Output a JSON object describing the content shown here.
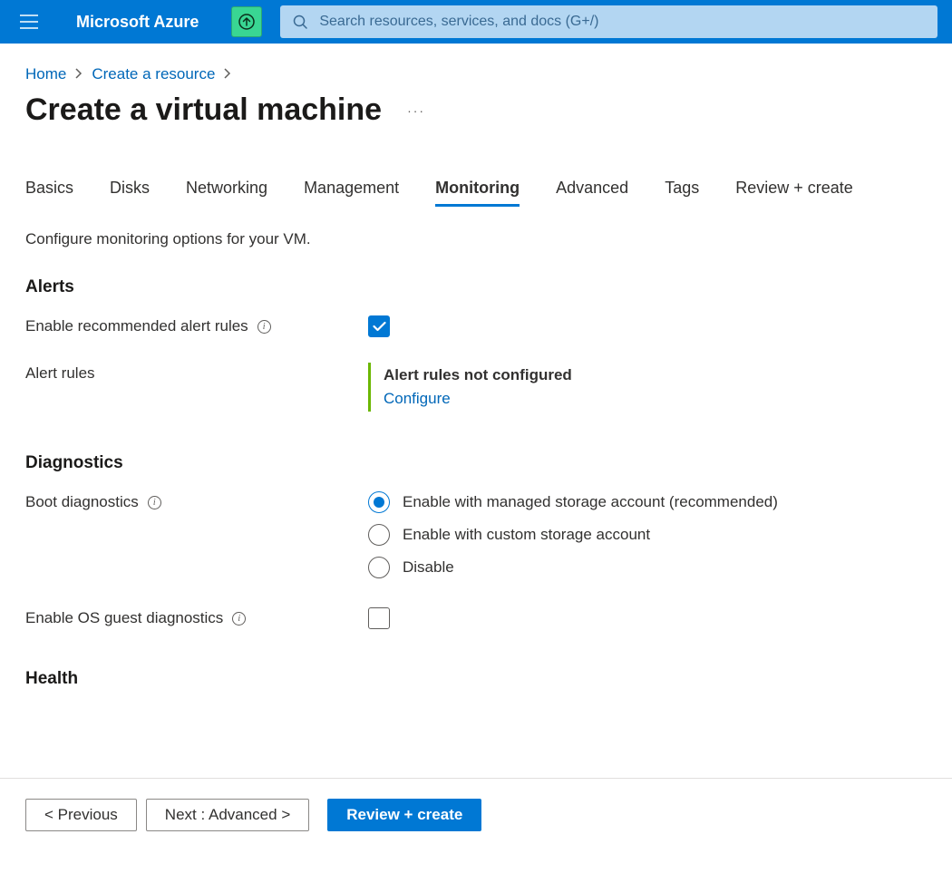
{
  "header": {
    "brand": "Microsoft Azure",
    "search_placeholder": "Search resources, services, and docs (G+/)"
  },
  "breadcrumb": {
    "items": [
      "Home",
      "Create a resource"
    ]
  },
  "page": {
    "title": "Create a virtual machine"
  },
  "tabs": {
    "items": [
      "Basics",
      "Disks",
      "Networking",
      "Management",
      "Monitoring",
      "Advanced",
      "Tags",
      "Review + create"
    ],
    "active_index": 4
  },
  "description": "Configure monitoring options for your VM.",
  "sections": {
    "alerts": {
      "title": "Alerts",
      "enable_recommended_label": "Enable recommended alert rules",
      "enable_recommended_checked": true,
      "alert_rules_label": "Alert rules",
      "alert_rules_status": "Alert rules not configured",
      "alert_rules_action": "Configure"
    },
    "diagnostics": {
      "title": "Diagnostics",
      "boot_diag_label": "Boot diagnostics",
      "boot_diag_options": [
        "Enable with managed storage account (recommended)",
        "Enable with custom storage account",
        "Disable"
      ],
      "boot_diag_selected_index": 0,
      "enable_os_guest_label": "Enable OS guest diagnostics",
      "enable_os_guest_checked": false
    },
    "health": {
      "title": "Health"
    }
  },
  "footer": {
    "previous": "< Previous",
    "next": "Next : Advanced >",
    "review": "Review + create"
  }
}
